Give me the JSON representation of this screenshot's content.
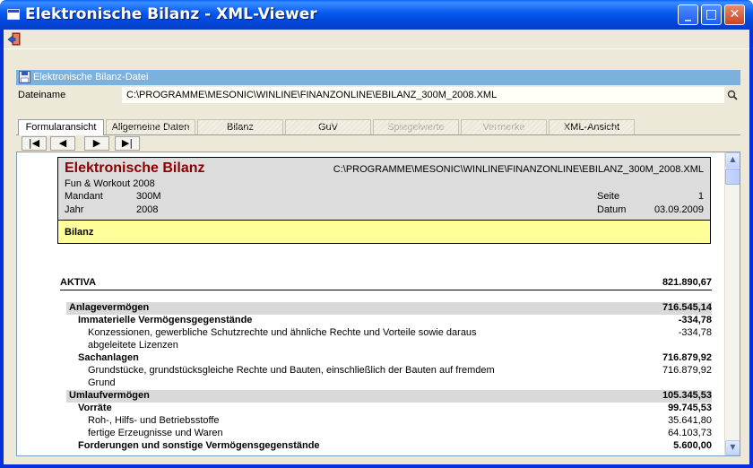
{
  "window": {
    "title": "Elektronische Bilanz - XML-Viewer",
    "min": "_",
    "max": "□",
    "close": "✕"
  },
  "section": {
    "title": "Elektronische Bilanz-Datei"
  },
  "file": {
    "label": "Dateiname",
    "value": "C:\\PROGRAMME\\MESONIC\\WINLINE\\FINANZONLINE\\EBILANZ_300M_2008.XML"
  },
  "tabs": [
    {
      "label": "Formularansicht",
      "state": "active"
    },
    {
      "label": "Allgemeine Daten",
      "state": "normal"
    },
    {
      "label": "Bilanz",
      "state": "normal"
    },
    {
      "label": "GuV",
      "state": "normal"
    },
    {
      "label": "Spiegelwerte",
      "state": "disabled"
    },
    {
      "label": "Vermerke",
      "state": "disabled"
    },
    {
      "label": "XML-Ansicht",
      "state": "normal"
    }
  ],
  "nav": {
    "first": "|◀",
    "prev": "◀",
    "next": "▶",
    "last": "▶|"
  },
  "doc": {
    "title": "Elektronische Bilanz",
    "path": "C:\\PROGRAMME\\MESONIC\\WINLINE\\FINANZONLINE\\EBILANZ_300M_2008.XML",
    "company": "Fun & Workout 2008",
    "mandant_label": "Mandant",
    "mandant_value": "300M",
    "jahr_label": "Jahr",
    "jahr_value": "2008",
    "seite_label": "Seite",
    "seite_value": "1",
    "datum_label": "Datum",
    "datum_value": "03.09.2009",
    "section": "Bilanz"
  },
  "rows": {
    "aktiva": {
      "label": "AKTIVA",
      "value": "821.890,67"
    },
    "anlage": {
      "label": "Anlagevermögen",
      "value": "716.545,14"
    },
    "immat": {
      "label": "Immaterielle Vermögensgegenstände",
      "value": "-334,78"
    },
    "konz1": {
      "label": "Konzessionen, gewerbliche Schutzrechte und ähnliche Rechte und Vorteile sowie daraus",
      "value": "-334,78"
    },
    "konz2": {
      "label": "abgeleitete Lizenzen"
    },
    "sach": {
      "label": "Sachanlagen",
      "value": "716.879,92"
    },
    "grund1": {
      "label": "Grundstücke, grundstücksgleiche Rechte und Bauten, einschließlich der Bauten auf fremdem",
      "value": "716.879,92"
    },
    "grund2": {
      "label": "Grund"
    },
    "umlauf": {
      "label": "Umlaufvermögen",
      "value": "105.345,53"
    },
    "vorr": {
      "label": "Vorräte",
      "value": "99.745,53"
    },
    "roh": {
      "label": "Roh-, Hilfs- und Betriebsstoffe",
      "value": "35.641,80"
    },
    "fertig": {
      "label": "fertige Erzeugnisse und Waren",
      "value": "64.103,73"
    },
    "ford": {
      "label": "Forderungen und sonstige Vermögensgegenstände",
      "value": "5.600,00"
    }
  },
  "scroll": {
    "up": "▲",
    "down": "▼"
  }
}
